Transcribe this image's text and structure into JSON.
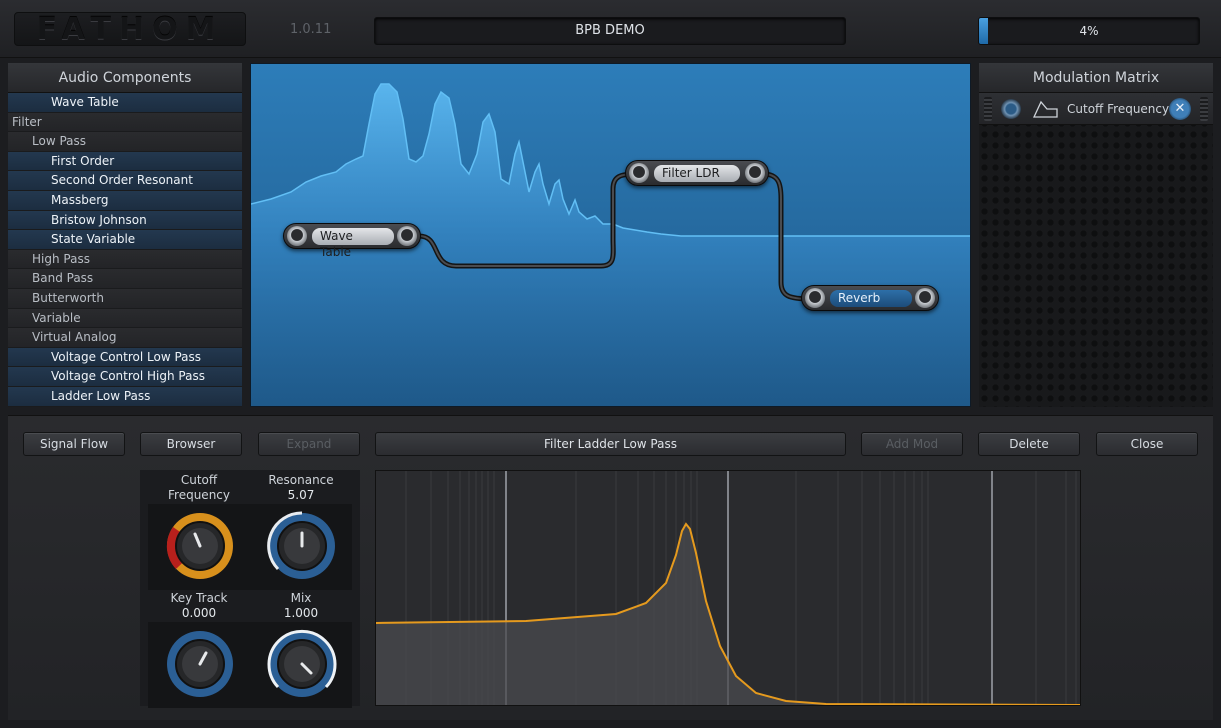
{
  "app": {
    "logo": "FATHOM",
    "version": "1.0.11",
    "preset": "BPB DEMO",
    "cpu": "4%",
    "cpu_fraction": 0.04
  },
  "audio_components": {
    "title": "Audio Components",
    "items": [
      {
        "label": "Wave Table",
        "level": 2,
        "kind": "leaf"
      },
      {
        "label": "Filter",
        "level": 0,
        "kind": "group"
      },
      {
        "label": "Low Pass",
        "level": 1,
        "kind": "group"
      },
      {
        "label": "First Order",
        "level": 2,
        "kind": "leaf"
      },
      {
        "label": "Second Order Resonant",
        "level": 2,
        "kind": "leaf"
      },
      {
        "label": "Massberg",
        "level": 2,
        "kind": "leaf"
      },
      {
        "label": "Bristow Johnson",
        "level": 2,
        "kind": "leaf"
      },
      {
        "label": "State Variable",
        "level": 2,
        "kind": "leaf"
      },
      {
        "label": "High Pass",
        "level": 1,
        "kind": "group"
      },
      {
        "label": "Band Pass",
        "level": 1,
        "kind": "group"
      },
      {
        "label": "Butterworth",
        "level": 1,
        "kind": "group"
      },
      {
        "label": "Variable",
        "level": 1,
        "kind": "group"
      },
      {
        "label": "Virtual Analog",
        "level": 1,
        "kind": "group"
      },
      {
        "label": "Voltage Control Low Pass",
        "level": 2,
        "kind": "leaf"
      },
      {
        "label": "Voltage Control High Pass",
        "level": 2,
        "kind": "leaf"
      },
      {
        "label": "Ladder Low Pass",
        "level": 2,
        "kind": "leaf"
      }
    ]
  },
  "signal_flow": {
    "nodes": {
      "wave_table": "Wave Table",
      "filter_ldr": "Filter LDR",
      "reverb": "Reverb"
    }
  },
  "modulation_matrix": {
    "title": "Modulation Matrix",
    "rows": [
      {
        "target": "Cutoff Frequency",
        "remove": "✕"
      }
    ]
  },
  "toolbar": {
    "signal_flow": "Signal Flow",
    "browser": "Browser",
    "expand": "Expand",
    "component_title": "Filter Ladder Low Pass",
    "add_mod": "Add Mod",
    "delete": "Delete",
    "close": "Close"
  },
  "knobs": {
    "cutoff": {
      "label": "Cutoff Frequency",
      "value": "780"
    },
    "resonance": {
      "label": "Resonance",
      "value": "5.07"
    },
    "key_track": {
      "label": "Key Track",
      "value": "0.000"
    },
    "mix": {
      "label": "Mix",
      "value": "1.000"
    }
  },
  "colors": {
    "accent_blue": "#2f86c9",
    "response_orange": "#e59a1e",
    "cutoff_red": "#b8201c"
  }
}
